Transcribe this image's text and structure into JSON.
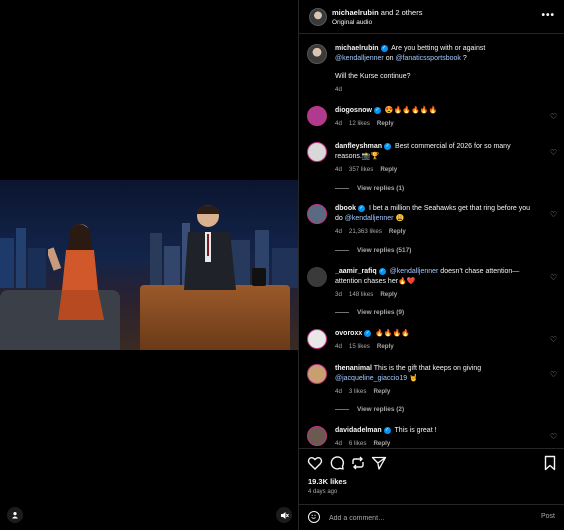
{
  "header": {
    "username": "michaelrubin",
    "others": "and 2 others",
    "audio": "Original audio"
  },
  "caption": {
    "username": "michaelrubin",
    "text_before": "Are you betting with or against",
    "mention1": "@kendalljenner",
    "text_mid": "on",
    "mention2": "@fanaticssportsbook",
    "text_after": "?",
    "line2": "Will the Kurse continue?",
    "time": "4d"
  },
  "comments": [
    {
      "username": "diogosnow",
      "verified": true,
      "text": "😍🔥🔥🔥🔥🔥",
      "time": "4d",
      "likes": "12 likes",
      "reply": "Reply"
    },
    {
      "username": "danfleyshman",
      "verified": true,
      "text": "Best commercial of 2026 for so many reasons.📸🏆",
      "time": "4d",
      "likes": "357 likes",
      "reply": "Reply",
      "view_replies": "View replies (1)"
    },
    {
      "username": "dbook",
      "verified": true,
      "text_before": "I bet a million the Seahawks get that ring before you do",
      "mention": "@kendalljenner",
      "text_after": "😩",
      "time": "4d",
      "likes": "21,363 likes",
      "reply": "Reply",
      "view_replies": "View replies (517)"
    },
    {
      "username": "_aamir_rafiq",
      "verified": true,
      "mention": "@kendalljenner",
      "text_after": "doesn’t chase attention—attention chases her🔥❤️",
      "time": "3d",
      "likes": "148 likes",
      "reply": "Reply",
      "view_replies": "View replies (9)"
    },
    {
      "username": "ovoroxx",
      "verified": true,
      "text": "🔥🔥🔥🔥",
      "time": "4d",
      "likes": "15 likes",
      "reply": "Reply"
    },
    {
      "username": "thenanimal",
      "verified": false,
      "text_before": "This is the gift that keeps on giving",
      "mention": "@jacqueline_giaccio19",
      "text_after": "🤘",
      "time": "4d",
      "likes": "3 likes",
      "reply": "Reply",
      "view_replies": "View replies (2)"
    },
    {
      "username": "davidadelman",
      "verified": true,
      "text": "This is great !",
      "time": "4d",
      "likes": "6 likes",
      "reply": "Reply"
    }
  ],
  "actions": {
    "likes": "19.3K likes",
    "ago": "4 days ago"
  },
  "add_comment": {
    "placeholder": "Add a comment…",
    "post": "Post"
  },
  "icons": [
    "user-icon",
    "mute-icon",
    "more-icon",
    "heart-icon",
    "comment-icon",
    "repost-icon",
    "share-icon",
    "bookmark-icon",
    "emoji-icon"
  ],
  "colors": {
    "accent": "#0095f6",
    "background": "#000000",
    "muted": "#a8a8a8"
  }
}
